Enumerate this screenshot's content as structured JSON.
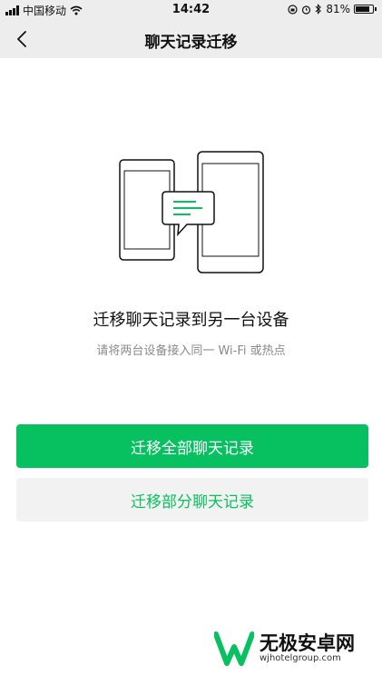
{
  "status_bar": {
    "carrier": "中国移动",
    "time": "14:42",
    "battery": "81%",
    "battery_level": 0.81
  },
  "nav": {
    "title": "聊天记录迁移"
  },
  "content": {
    "heading": "迁移聊天记录到另一台设备",
    "subtext": "请将两台设备接入同一 Wi-Fi 或热点"
  },
  "buttons": {
    "migrate_all": "迁移全部聊天记录",
    "migrate_part": "迁移部分聊天记录"
  },
  "watermark": {
    "name": "无极安卓网",
    "url": "wjhotelgroup.com"
  },
  "colors": {
    "accent": "#07c160",
    "nav_background": "#ededed",
    "secondary_button": "#f2f2f2"
  }
}
